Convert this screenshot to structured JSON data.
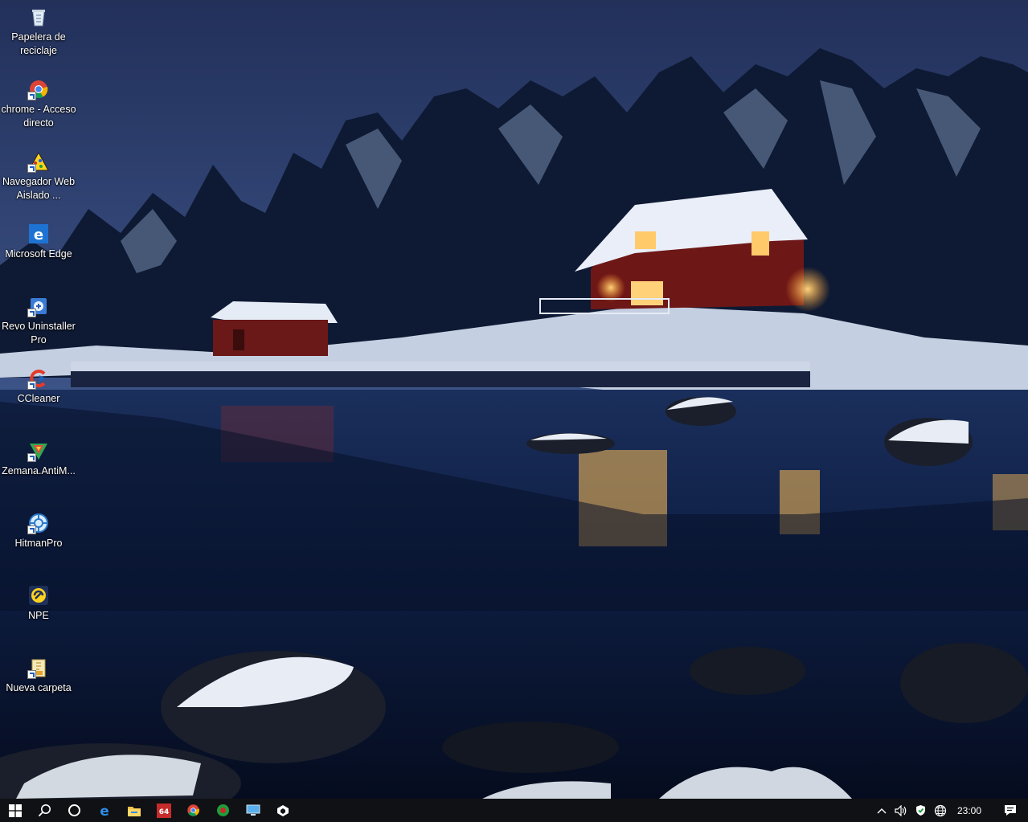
{
  "desktop": {
    "icons": [
      {
        "label": "Papelera de reciclaje",
        "icon": "recycle-bin-icon"
      },
      {
        "label": "chrome - Acceso directo",
        "icon": "chrome-icon"
      },
      {
        "label": "Navegador Web Aislado ...",
        "icon": "isolated-browser-icon"
      },
      {
        "label": "Microsoft Edge",
        "icon": "edge-icon"
      },
      {
        "label": "Revo Uninstaller Pro",
        "icon": "revo-uninstaller-icon"
      },
      {
        "label": "CCleaner",
        "icon": "ccleaner-icon"
      },
      {
        "label": "Zemana.AntiM...",
        "icon": "zemana-icon"
      },
      {
        "label": "HitmanPro",
        "icon": "hitmanpro-icon"
      },
      {
        "label": "NPE",
        "icon": "npe-icon"
      },
      {
        "label": "Nueva carpeta",
        "icon": "folder-icon"
      }
    ]
  },
  "taskbar": {
    "buttons": [
      {
        "icon": "windows-start-icon"
      },
      {
        "icon": "search-icon"
      },
      {
        "icon": "cortana-icon"
      },
      {
        "icon": "edge-icon"
      },
      {
        "icon": "file-explorer-icon"
      },
      {
        "icon": "app-64-icon",
        "text": "64"
      },
      {
        "icon": "chrome-icon"
      },
      {
        "icon": "green-app-icon"
      },
      {
        "icon": "monitor-icon"
      },
      {
        "icon": "sandbox-icon"
      }
    ],
    "tray": {
      "time": "23:00",
      "icons": [
        "chevron-up-icon",
        "volume-icon",
        "shield-icon",
        "network-icon",
        "notifications-icon"
      ]
    }
  },
  "colors": {
    "taskbar_bg": "#101114",
    "sky_top": "#23345f",
    "water": "#0a1a3a",
    "cabin_red": "#7a1a1a",
    "light_glow": "#ffb64a"
  }
}
